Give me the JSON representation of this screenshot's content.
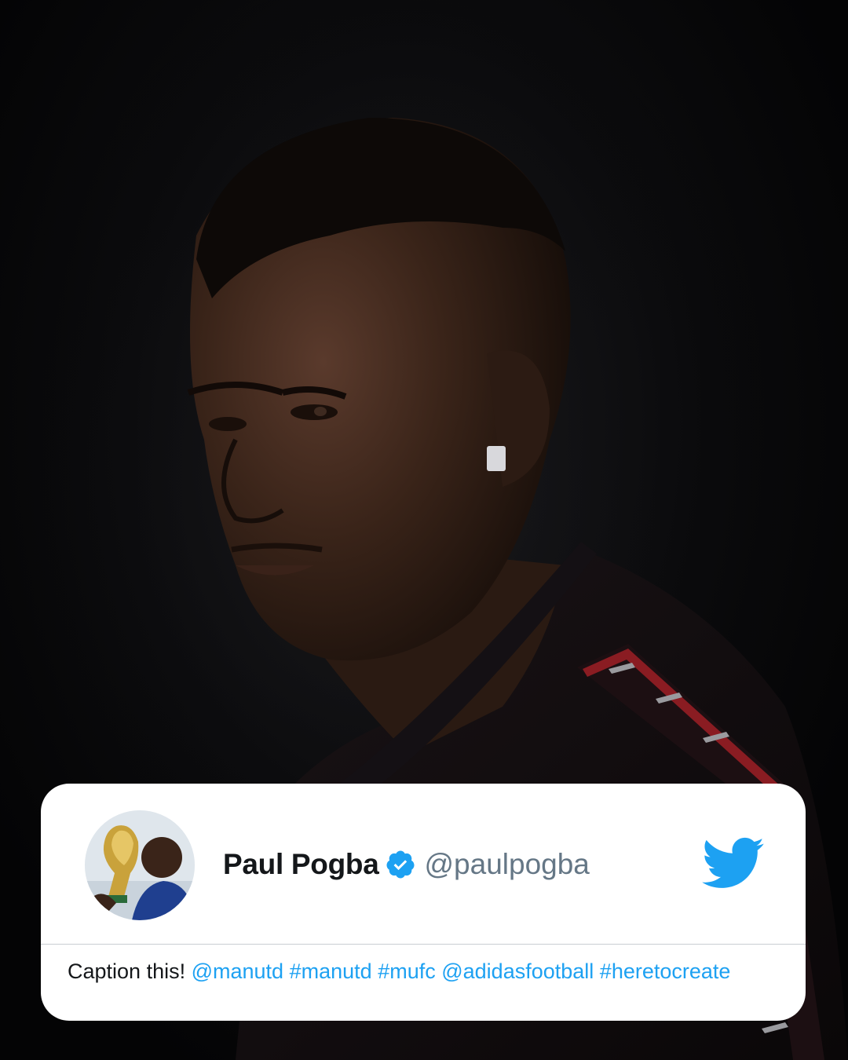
{
  "tweet": {
    "display_name": "Paul Pogba",
    "handle": "@paulpogba",
    "verified": true,
    "text_plain": "Caption this!",
    "entities": [
      "@manutd",
      "#manutd",
      "#mufc",
      "@adidasfootball",
      "#heretocreate"
    ]
  },
  "icons": {
    "verified": "verified-badge-icon",
    "brand": "twitter-bird-icon"
  },
  "colors": {
    "twitter_blue": "#1da1f2",
    "handle_gray": "#657786",
    "name_black": "#14171a",
    "card_bg": "#ffffff",
    "background": "#050506",
    "jacket_stripe": "#8a1c22"
  }
}
